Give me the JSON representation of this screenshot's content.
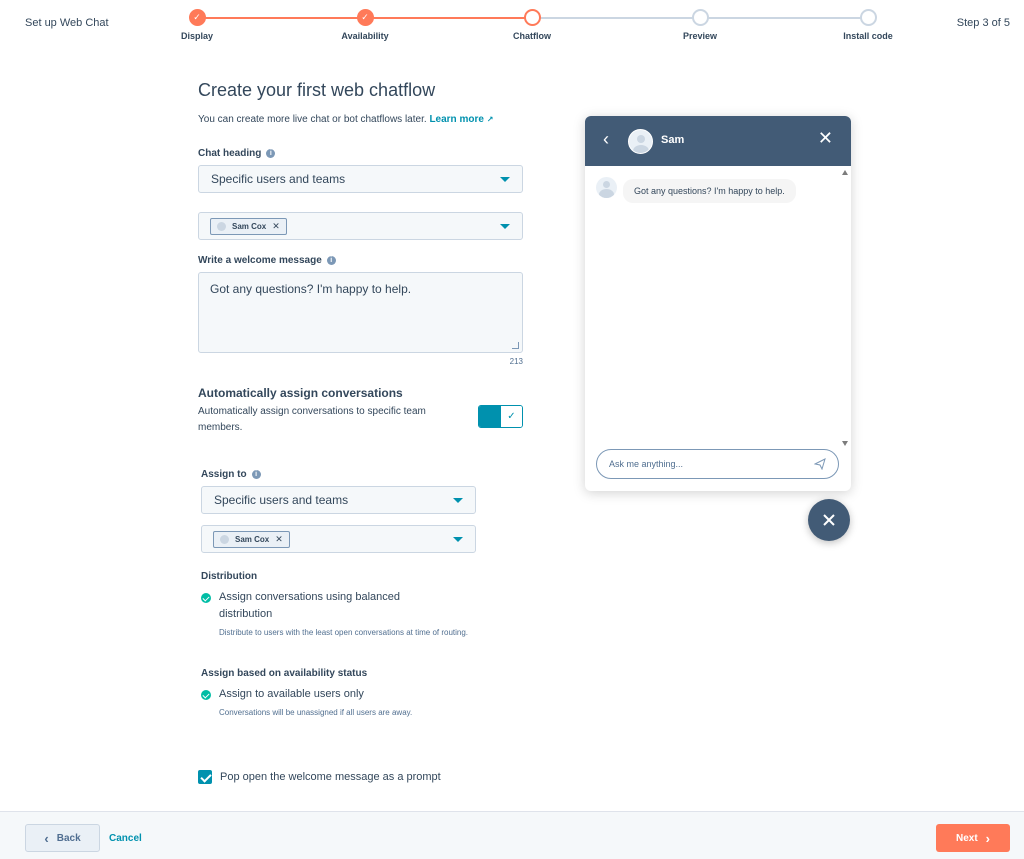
{
  "header": {
    "app_title": "Set up Web Chat",
    "step_count": "Step 3 of 5",
    "steps": [
      {
        "label": "Display",
        "state": "done"
      },
      {
        "label": "Availability",
        "state": "done"
      },
      {
        "label": "Chatflow",
        "state": "active"
      },
      {
        "label": "Preview",
        "state": "todo"
      },
      {
        "label": "Install code",
        "state": "todo"
      }
    ]
  },
  "form": {
    "title": "Create your first web chatflow",
    "subtitle": "You can create more live chat or bot chatflows later.",
    "learn_more": "Learn more",
    "chat_heading_label": "Chat heading",
    "chat_heading_value": "Specific users and teams",
    "chat_heading_tag": "Sam Cox",
    "welcome_label": "Write a welcome message",
    "welcome_value": "Got any questions? I'm happy to help.",
    "char_count": "213",
    "auto_assign_title": "Automatically assign conversations",
    "auto_assign_desc": "Automatically assign conversations to specific team members.",
    "auto_assign_enabled": true,
    "assign_to_label": "Assign to",
    "assign_to_value": "Specific users and teams",
    "assign_to_tag": "Sam Cox",
    "distribution_label": "Distribution",
    "distribution_option": "Assign conversations using balanced distribution",
    "distribution_help": "Distribute to users with the least open conversations at time of routing.",
    "availability_label": "Assign based on availability status",
    "availability_option": "Assign to available users only",
    "availability_help": "Conversations will be unassigned if all users are away.",
    "popup_checkbox_label": "Pop open the welcome message as a prompt",
    "popup_checked": true
  },
  "preview": {
    "agent_name": "Sam",
    "message": "Got any questions? I'm happy to help.",
    "input_placeholder": "Ask me anything..."
  },
  "footer": {
    "back_label": "Back",
    "cancel_label": "Cancel",
    "next_label": "Next"
  },
  "colors": {
    "accent": "#ff7a59",
    "link": "#0091ae",
    "chat_header": "#425b76",
    "success": "#00bda5"
  }
}
